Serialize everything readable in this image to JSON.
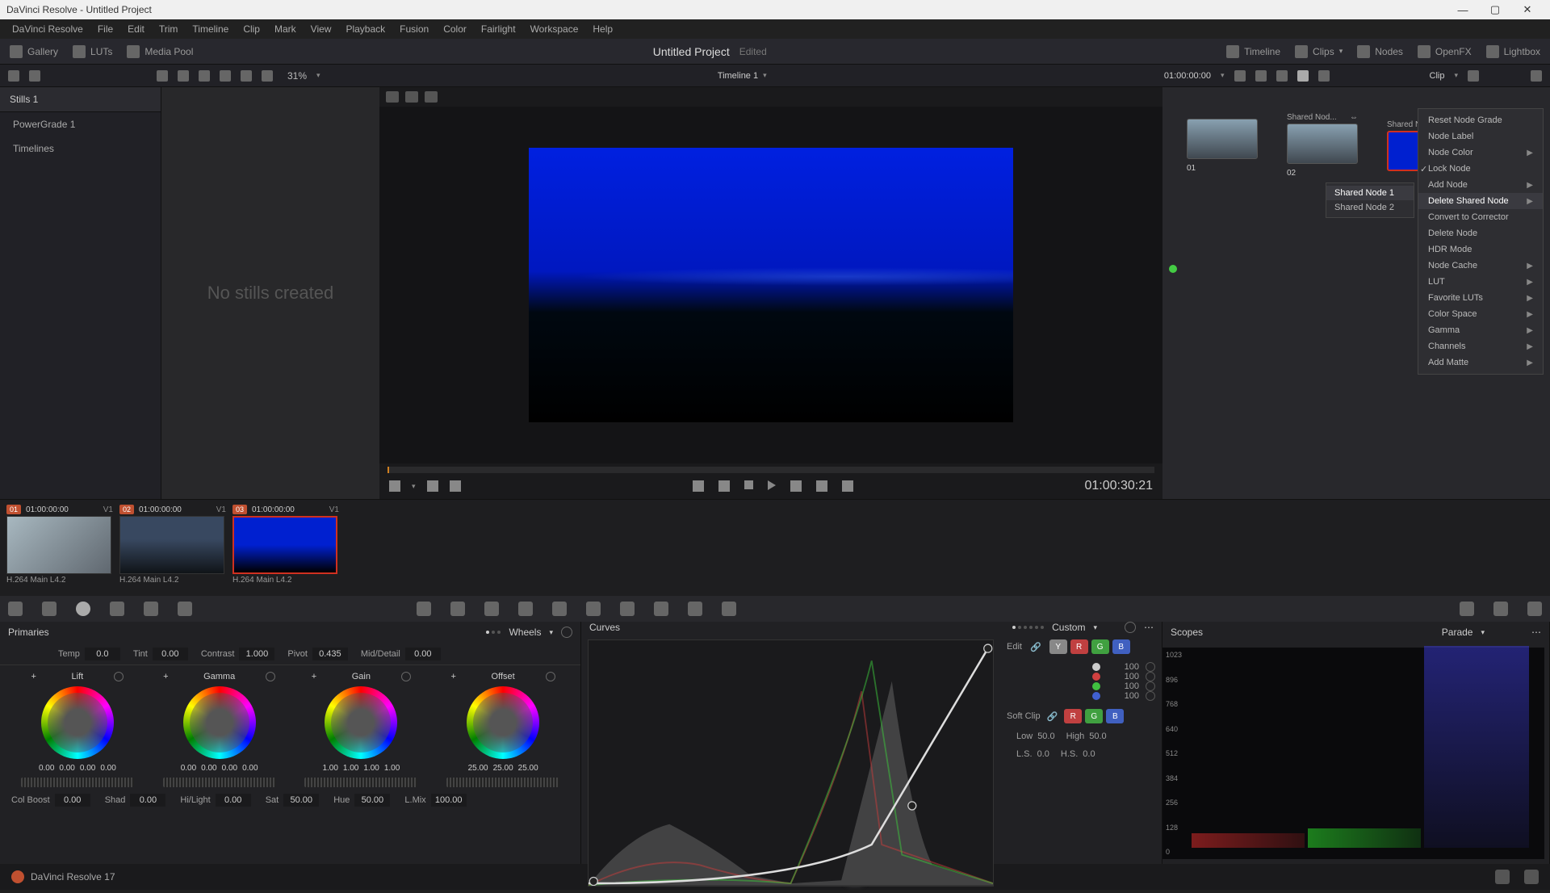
{
  "titlebar": "DaVinci Resolve - Untitled Project",
  "menubar": [
    "DaVinci Resolve",
    "File",
    "Edit",
    "Trim",
    "Timeline",
    "Clip",
    "Mark",
    "View",
    "Playback",
    "Fusion",
    "Color",
    "Fairlight",
    "Workspace",
    "Help"
  ],
  "toolbar": {
    "gallery": "Gallery",
    "luts": "LUTs",
    "mediapool": "Media Pool",
    "project": "Untitled Project",
    "edited": "Edited",
    "timeline": "Timeline",
    "clips": "Clips",
    "nodes": "Nodes",
    "openfx": "OpenFX",
    "lightbox": "Lightbox"
  },
  "subtoolbar": {
    "zoom": "31%",
    "timeline_name": "Timeline 1",
    "timecode": "01:00:00:00",
    "mode": "Clip"
  },
  "sidebar": {
    "stills_tab": "Stills 1",
    "items": [
      "PowerGrade 1",
      "Timelines"
    ]
  },
  "stills_empty": "No stills created",
  "transport": {
    "timecode": "01:00:30:21"
  },
  "nodes": {
    "n1_label": "Shared Nod...",
    "n2_label": "Shared Nod...",
    "n1_num": "01",
    "n2_num": "02"
  },
  "context_menu": [
    {
      "label": "Reset Node Grade"
    },
    {
      "label": "Node Label"
    },
    {
      "label": "Node Color",
      "arrow": true
    },
    {
      "label": "Lock Node",
      "checked": true
    },
    {
      "label": "Add Node",
      "arrow": true
    },
    {
      "label": "Delete Shared Node",
      "arrow": true,
      "hover": true
    },
    {
      "label": "Convert to Corrector"
    },
    {
      "label": "Delete Node"
    },
    {
      "label": "HDR Mode"
    },
    {
      "label": "Node Cache",
      "arrow": true
    },
    {
      "label": "LUT",
      "arrow": true
    },
    {
      "label": "Favorite LUTs",
      "arrow": true
    },
    {
      "label": "Color Space",
      "arrow": true
    },
    {
      "label": "Gamma",
      "arrow": true
    },
    {
      "label": "Channels",
      "arrow": true
    },
    {
      "label": "Add Matte",
      "arrow": true
    }
  ],
  "submenu": [
    "Shared Node 1",
    "Shared Node 2"
  ],
  "clips": [
    {
      "num": "01",
      "tc": "01:00:00:00",
      "track": "V1",
      "codec": "H.264 Main L4.2",
      "cls": "c1"
    },
    {
      "num": "02",
      "tc": "01:00:00:00",
      "track": "V1",
      "codec": "H.264 Main L4.2",
      "cls": "c2"
    },
    {
      "num": "03",
      "tc": "01:00:00:00",
      "track": "V1",
      "codec": "H.264 Main L4.2",
      "cls": "c3"
    }
  ],
  "primaries": {
    "title": "Primaries",
    "wheels_label": "Wheels",
    "temp": {
      "label": "Temp",
      "val": "0.0"
    },
    "tint": {
      "label": "Tint",
      "val": "0.00"
    },
    "contrast": {
      "label": "Contrast",
      "val": "1.000"
    },
    "pivot": {
      "label": "Pivot",
      "val": "0.435"
    },
    "middetail": {
      "label": "Mid/Detail",
      "val": "0.00"
    },
    "wheels": [
      {
        "name": "Lift",
        "nums": [
          "0.00",
          "0.00",
          "0.00",
          "0.00"
        ]
      },
      {
        "name": "Gamma",
        "nums": [
          "0.00",
          "0.00",
          "0.00",
          "0.00"
        ]
      },
      {
        "name": "Gain",
        "nums": [
          "1.00",
          "1.00",
          "1.00",
          "1.00"
        ]
      },
      {
        "name": "Offset",
        "nums": [
          "25.00",
          "25.00",
          "25.00"
        ]
      }
    ],
    "bottom": {
      "colboost": {
        "label": "Col Boost",
        "val": "0.00"
      },
      "shad": {
        "label": "Shad",
        "val": "0.00"
      },
      "hilight": {
        "label": "Hi/Light",
        "val": "0.00"
      },
      "sat": {
        "label": "Sat",
        "val": "50.00"
      },
      "hue": {
        "label": "Hue",
        "val": "50.00"
      },
      "lmix": {
        "label": "L.Mix",
        "val": "100.00"
      }
    }
  },
  "curves": {
    "title": "Curves",
    "custom": "Custom",
    "edit": "Edit",
    "channels": [
      {
        "color": "#ccc",
        "val": "100"
      },
      {
        "color": "#d04040",
        "val": "100"
      },
      {
        "color": "#40c040",
        "val": "100"
      },
      {
        "color": "#4060d0",
        "val": "100"
      }
    ],
    "softclip": "Soft Clip",
    "low": {
      "label": "Low",
      "val": "50.0"
    },
    "high": {
      "label": "High",
      "val": "50.0"
    },
    "ls": {
      "label": "L.S.",
      "val": "0.0"
    },
    "hs": {
      "label": "H.S.",
      "val": "0.0"
    }
  },
  "scopes": {
    "title": "Scopes",
    "mode": "Parade",
    "labels": [
      "1023",
      "896",
      "768",
      "640",
      "512",
      "384",
      "256",
      "128",
      "0"
    ]
  },
  "bottombar": {
    "app": "DaVinci Resolve 17"
  }
}
